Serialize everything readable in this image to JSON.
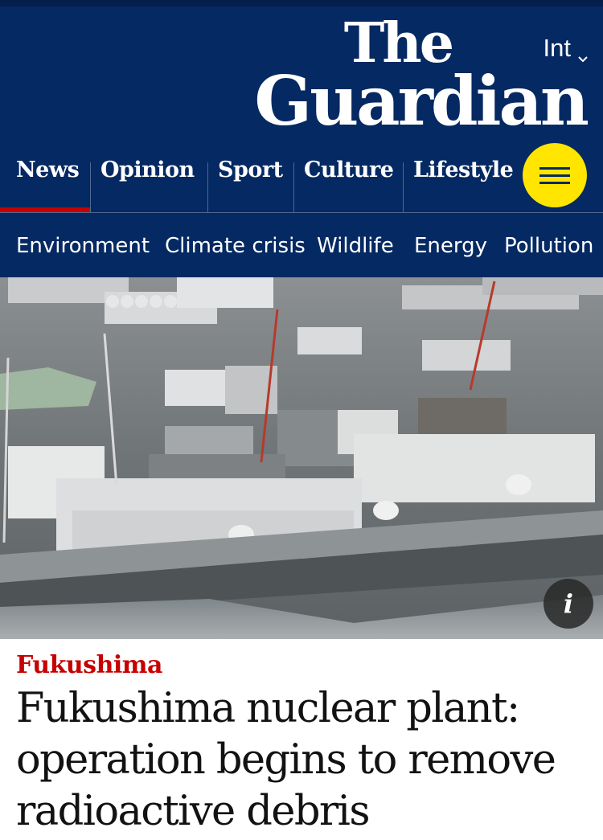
{
  "header": {
    "edition": "Int",
    "logo_line1": "The",
    "logo_line2": "Guardian",
    "brand_color": "#052962",
    "accent_color": "#ffe500",
    "active_underline_color": "#c70000"
  },
  "pillars": [
    {
      "label": "News",
      "active": true
    },
    {
      "label": "Opinion",
      "active": false
    },
    {
      "label": "Sport",
      "active": false
    },
    {
      "label": "Culture",
      "active": false
    },
    {
      "label": "Lifestyle",
      "active": false
    }
  ],
  "menu_icon": "hamburger-menu-icon",
  "subnav": [
    "Environment",
    "Climate crisis",
    "Wildlife",
    "Energy",
    "Pollution"
  ],
  "photo": {
    "info_label": "i",
    "info_icon": "info-icon"
  },
  "article": {
    "kicker": "Fukushima",
    "headline": "Fukushima nuclear plant: operation begins to remove radioactive debris",
    "kicker_color": "#c70000"
  }
}
